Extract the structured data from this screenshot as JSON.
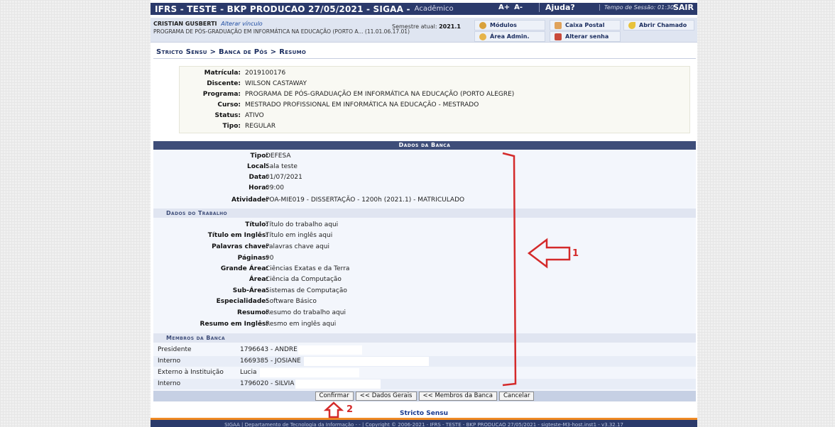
{
  "header": {
    "system_title": "IFRS - TESTE - BKP PRODUCAO 27/05/2021 - SIGAA -",
    "system_subtitle": "Acadêmico",
    "font_increase": "A+",
    "font_decrease": "A-",
    "help": "Ajuda?",
    "session": "Tempo de Sessão: 01:30",
    "exit": "SAIR"
  },
  "user_bar": {
    "user_name": "CRISTIAN GUSBERTI",
    "change_link": "Alterar vínculo",
    "program": "PROGRAMA DE PÓS-GRADUAÇÃO EM INFORMÁTICA NA EDUCAÇÃO (PORTO A... (11.01.06.17.01)",
    "semester_label": "Semestre atual:",
    "semester_value": "2021.1",
    "buttons": {
      "modulos": "Módulos",
      "caixa_postal": "Caixa Postal",
      "abrir_chamado": "Abrir Chamado",
      "area_admin": "Área Admin.",
      "alterar_senha": "Alterar senha"
    }
  },
  "breadcrumb": "Stricto Sensu > Banca de Pós > Resumo",
  "student": [
    {
      "label": "Matrícula:",
      "value": "2019100176"
    },
    {
      "label": "Discente:",
      "value": "WILSON CASTAWAY"
    },
    {
      "label": "Programa:",
      "value": "PROGRAMA DE PÓS-GRADUAÇÃO EM INFORMÁTICA NA EDUCAÇÃO (PORTO ALEGRE)"
    },
    {
      "label": "Curso:",
      "value": "MESTRADO PROFISSIONAL EM INFORMÁTICA NA EDUCAÇÃO - MESTRADO"
    },
    {
      "label": "Status:",
      "value": "ATIVO"
    },
    {
      "label": "Tipo:",
      "value": "REGULAR"
    }
  ],
  "banca": {
    "header": "Dados da Banca",
    "fields": [
      {
        "label": "Tipo:",
        "value": "DEFESA"
      },
      {
        "label": "Local:",
        "value": "Sala teste"
      },
      {
        "label": "Data:",
        "value": "01/07/2021"
      },
      {
        "label": "Hora:",
        "value": "09:00"
      },
      {
        "label": "Atividade:",
        "value": "POA-MIE019 - DISSERTAÇÃO - 1200h (2021.1) - MATRICULADO"
      }
    ],
    "trabalho_header": "Dados do Trabalho",
    "trabalho": [
      {
        "label": "Título:",
        "value": "Título do trabalho aqui"
      },
      {
        "label": "Título em Inglês:",
        "value": "Título em inglês aqui"
      },
      {
        "label": "Palavras chave:",
        "value": "Palavras chave aqui"
      },
      {
        "label": "Páginas:",
        "value": "90"
      },
      {
        "label": "Grande Área:",
        "value": "Ciências Exatas e da Terra"
      },
      {
        "label": "Área:",
        "value": "Ciência da Computação"
      },
      {
        "label": "Sub-Área:",
        "value": "Sistemas de Computação"
      },
      {
        "label": "Especialidade:",
        "value": "Software Básico"
      },
      {
        "label": "Resumo:",
        "value": "Resumo do trabalho aqui"
      },
      {
        "label": "Resumo em Inglês:",
        "value": "Resmo em inglês aqui"
      }
    ],
    "membros_header": "Membros da Banca",
    "membros": [
      {
        "role": "Presidente",
        "name": "1796643 - ANDRE"
      },
      {
        "role": "Interno",
        "name": "1669385 - JOSIANE"
      },
      {
        "role": "Externo à Instituição",
        "name": "Lucia"
      },
      {
        "role": "Interno",
        "name": "1796020 - SILVIA"
      }
    ]
  },
  "actions": {
    "confirm": "Confirmar",
    "dados_gerais": "<< Dados Gerais",
    "membros_banca": "<< Membros da Banca",
    "cancel": "Cancelar"
  },
  "footer": {
    "link": "Stricto Sensu",
    "text": "SIGAA | Departamento de Tecnologia da Informação - - | Copyright © 2006-2021 - IFRS - TESTE - BKP PRODUCAO 27/05/2021 - sigteste-M3-host.inst1 - v3.32.17"
  },
  "annotations": {
    "marker_1": "1",
    "marker_2": "2",
    "color": "#d42a2a"
  },
  "colors": {
    "header_blue": "#2b3a6b",
    "section_blue": "#3e4d79",
    "footer_accent": "#f08a24"
  }
}
